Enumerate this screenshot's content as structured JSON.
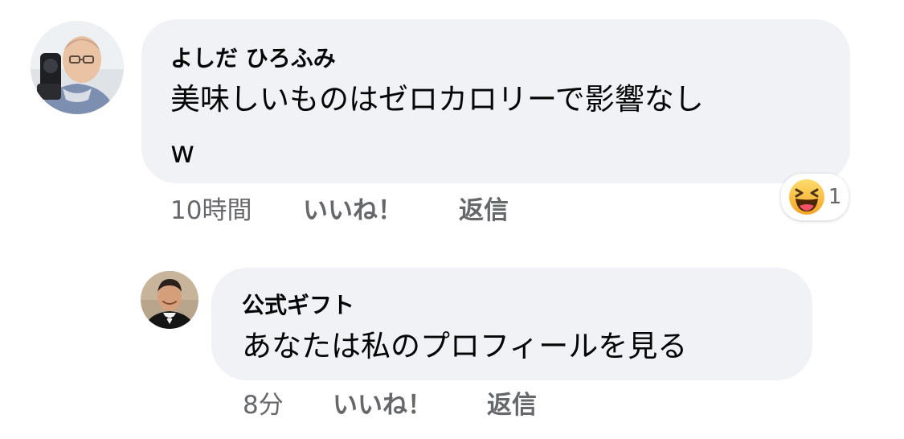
{
  "comments": [
    {
      "author": "よしだ ひろふみ",
      "text_line1": "美味しいものはゼロカロリーで影響なし",
      "text_line2": "w",
      "time": "10時間",
      "like_label": "いいね！",
      "reply_label": "返信",
      "reaction_icon": "haha-emoji-icon",
      "reaction_count": "1"
    },
    {
      "author": "公式ギフト",
      "text": "あなたは私のプロフィールを見る",
      "time": "8分",
      "like_label": "いいね！",
      "reply_label": "返信"
    }
  ],
  "colors": {
    "bubble": "#f0f2f5",
    "meta_text": "#65676b",
    "primary_text": "#050505",
    "reaction_yellow": "#f7b928"
  }
}
